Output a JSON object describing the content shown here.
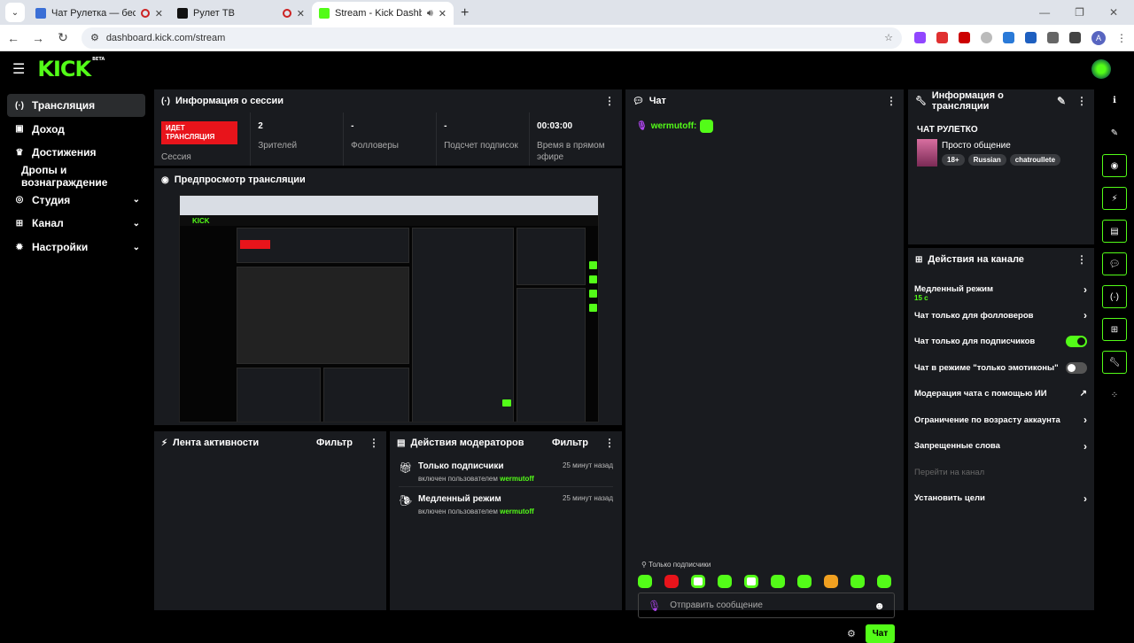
{
  "browser": {
    "tabs": [
      {
        "title": "Чат Рулетка — бесплатный",
        "active": false
      },
      {
        "title": "Рулет ТВ",
        "active": false
      },
      {
        "title": "Stream - Kick Dashboard",
        "active": true
      }
    ],
    "url": "dashboard.kick.com/stream",
    "profile": "A"
  },
  "app": {
    "logo": "KICK",
    "logo_badge": "BETA"
  },
  "sidebar": {
    "items": [
      {
        "label": "Трансляция",
        "icon": "broadcast-icon",
        "active": true
      },
      {
        "label": "Доход",
        "icon": "money-icon"
      },
      {
        "label": "Достижения",
        "icon": "trophy-icon"
      },
      {
        "label": "Дропы и вознаграждение"
      },
      {
        "label": "Студия",
        "icon": "studio-icon",
        "chevron": true
      },
      {
        "label": "Канал",
        "icon": "channel-icon",
        "chevron": true
      },
      {
        "label": "Настройки",
        "icon": "gear-icon",
        "chevron": true
      }
    ]
  },
  "session": {
    "title": "Информация о сессии",
    "live_badge": "ИДЕТ ТРАНСЛЯЦИЯ",
    "session_label": "Сессия",
    "stats": [
      {
        "value": "2",
        "label": "Зрителей"
      },
      {
        "value": "-",
        "label": "Фолловеры"
      },
      {
        "value": "-",
        "label": "Подсчет подписок"
      },
      {
        "value": "00:03:00",
        "label": "Время в прямом эфире"
      }
    ]
  },
  "preview": {
    "title": "Предпросмотр трансляции"
  },
  "activity": {
    "title": "Лента активности",
    "filter": "Фильтр"
  },
  "mod_actions": {
    "title": "Действия модераторов",
    "filter": "Фильтр",
    "items": [
      {
        "title": "Только подписчики",
        "by": "включен пользователем",
        "user": "wermutoff",
        "time": "25 минут назад"
      },
      {
        "title": "Медленный режим",
        "by": "включен пользователем",
        "user": "wermutoff",
        "time": "25 минут назад"
      }
    ]
  },
  "chat": {
    "title": "Чат",
    "message_user": "wermutoff:",
    "mode": "Только подписчики",
    "input_placeholder": "Отправить сообщение",
    "send_label": "Чат"
  },
  "stream_info": {
    "title": "Информация о трансляции",
    "stream_title": "ЧАТ РУЛЕТКО",
    "category": "Просто общение",
    "tags": [
      "18+",
      "Russian",
      "chatroullete"
    ]
  },
  "channel_actions": {
    "title": "Действия на канале",
    "items": [
      {
        "label": "Медленный режим",
        "sub": "15 с",
        "type": "arrow"
      },
      {
        "label": "Чат только для фолловеров",
        "type": "arrow"
      },
      {
        "label": "Чат только для подписчиков",
        "type": "toggle",
        "on": true
      },
      {
        "label": "Чат в режиме \"только эмотиконы\"",
        "type": "toggle",
        "on": false
      },
      {
        "label": "Модерация чата с помощью ИИ",
        "type": "external"
      },
      {
        "label": "Ограничение по возрасту аккаунта",
        "type": "arrow"
      },
      {
        "label": "Запрещенные слова",
        "type": "arrow"
      },
      {
        "label": "Перейти на канал",
        "type": "disabled"
      },
      {
        "label": "Установить цели",
        "type": "arrow"
      }
    ]
  },
  "colors": {
    "accent": "#53fc18",
    "live": "#e8141b",
    "panel": "#191b1f",
    "bg": "#000000"
  }
}
